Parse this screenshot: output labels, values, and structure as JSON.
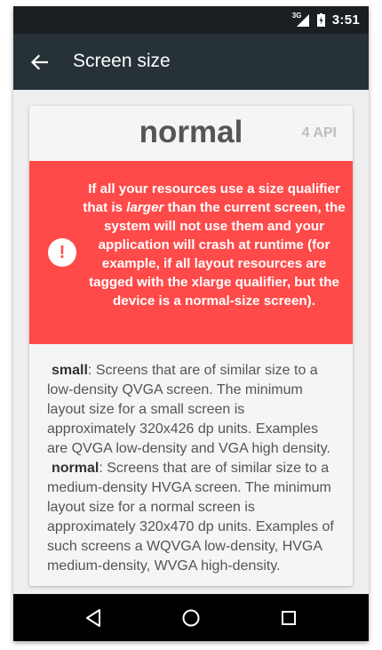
{
  "status_bar": {
    "network_label": "3G",
    "time": "3:51"
  },
  "app_bar": {
    "title": "Screen size"
  },
  "card": {
    "size_name": "normal",
    "api_label": "4 API",
    "warning": {
      "text_before": "If all your resources use a size qualifier that is ",
      "text_emphasis": "larger",
      "text_after": " than the current screen, the system will not use them and your application will crash at runtime (for example, if all layout resources are tagged with the xlarge qualifier, but the device is a normal-size screen).",
      "icon_glyph": "!"
    },
    "descriptions": [
      {
        "term": "small",
        "text": ": Screens that are of similar size to a low-density QVGA screen. The minimum layout size for a small screen is approximately 320x426 dp units. Examples are QVGA low-density and VGA high density."
      },
      {
        "term": "normal",
        "text": ": Screens that are of similar size to a medium-density HVGA screen. The minimum layout size for a normal screen is approximately 320x470 dp units. Examples of such screens a WQVGA low-density, HVGA medium-density, WVGA high-density."
      }
    ]
  },
  "colors": {
    "status_bar_bg": "#1a1f22",
    "app_bar_bg": "#263238",
    "warning_bg": "#ff4a4a",
    "card_bg": "#f5f5f5",
    "page_bg": "#eeeeee",
    "nav_bar_bg": "#000000"
  },
  "icons": {
    "back": "arrow-left",
    "signal": "cell-signal",
    "battery": "battery-charging",
    "nav_back": "triangle-back",
    "nav_home": "circle-home",
    "nav_recents": "square-recents"
  }
}
